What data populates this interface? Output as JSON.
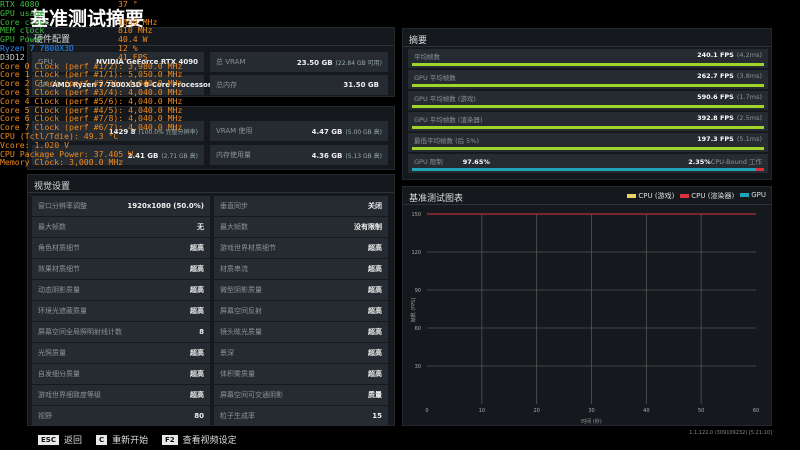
{
  "title": "基准测试摘要",
  "osd": {
    "lines": [
      {
        "label": "RTX 4080",
        "value": "37 °",
        "c": "g"
      },
      {
        "label": "GPU usage",
        "value": "",
        "c": "g"
      },
      {
        "label": "Core clock",
        "value": "1080 MHz",
        "c": "g"
      },
      {
        "label": "MEM clock",
        "value": "810 MHz",
        "c": "g"
      },
      {
        "label": "GPU Power",
        "value": "40.4 W",
        "c": "g"
      },
      {
        "label": "Ryzen 7 7800X3D",
        "value": "12 %",
        "c": "b"
      },
      {
        "label": "D3D12",
        "value": "41 FPS",
        "c": "w"
      }
    ],
    "details": [
      "Core 0 Clock (perf #1/2): 3,980.0 MHz",
      "Core 1 Clock (perf #1/1): 5,050.0 MHz",
      "Core 2 Clock (perf #2/3): 4,040.0 MHz",
      "Core 3 Clock (perf #3/4): 4,040.0 MHz",
      "Core 4 Clock (perf #5/6): 4,040.0 MHz",
      "Core 5 Clock (perf #4/5): 4,040.0 MHz",
      "Core 6 Clock (perf #7/8): 4,040.0 MHz",
      "Core 7 Clock (perf #6/7): 4,040.0 MHz",
      "CPU (Tctl/Tdie): 49.3 °C",
      "Vcore: 1.020 V",
      "CPU Package Power: 37.405 W",
      "Memory Clock: 3,000.0 MHz"
    ]
  },
  "hardware": {
    "header": "硬件配置",
    "rows": [
      {
        "l": "GPU",
        "v": "NVIDIA GeForce RTX 4090",
        "l2": "总 VRAM",
        "v2": "23.50 GB",
        "s2": "(22.84 GB 可用)"
      },
      {
        "l": "CPU",
        "v": "AMD Ryzen 7 7800X3D 8-Core Processor",
        "l2": "总内存",
        "v2": "31.50 GB",
        "s2": ""
      }
    ]
  },
  "usage": {
    "rows": [
      {
        "l": "",
        "v": "1429 8",
        "s": "(100.0% 完整分辨率)",
        "l2": "VRAM 使用",
        "v2": "4.47 GB",
        "s2": "(5.00 GB 高)"
      },
      {
        "l": "",
        "v": "2.41 GB",
        "s": "(2.71 GB 高)",
        "l2": "内存使用量",
        "v2": "4.36 GB",
        "s2": "(5.13 GB 高)"
      }
    ]
  },
  "visual": {
    "header": "视觉设置",
    "rows": [
      [
        "窗口分辨率调整",
        "1920x1080 (50.0%)",
        "垂直同步",
        "关闭"
      ],
      [
        "最大帧数",
        "无",
        "最大帧数",
        "没有限制"
      ],
      [
        "角色材质细节",
        "超高",
        "游戏世界材质细节",
        "超高"
      ],
      [
        "效果材质细节",
        "超高",
        "材质串流",
        "超高"
      ],
      [
        "动态阴影质量",
        "超高",
        "微型阴影质量",
        "超高"
      ],
      [
        "环境光遮蔽质量",
        "超高",
        "屏幕空间反射",
        "超高"
      ],
      [
        "屏幕空间全局照明射线计数",
        "8",
        "镜头眩光质量",
        "超高"
      ],
      [
        "光照质量",
        "超高",
        "景深",
        "超高"
      ],
      [
        "自发细分质量",
        "超高",
        "体积雾质量",
        "超高"
      ],
      [
        "游戏世界细致度等级",
        "超高",
        "屏幕空间可交通阴影",
        "质量"
      ],
      [
        "视野",
        "80",
        "粒子生成率",
        "15"
      ]
    ]
  },
  "summary": {
    "header": "摘要",
    "rows": [
      {
        "l": "平均帧数",
        "v": "240.1 FPS",
        "s": "(4.2ms)"
      },
      {
        "l": "GPU 平均帧数",
        "v": "262.7 FPS",
        "s": "(3.8ms)"
      },
      {
        "l": "GPU 平均帧数 (游戏)",
        "v": "590.6 FPS",
        "s": "(1.7ms)"
      },
      {
        "l": "GPU 平均帧数 (渲染器)",
        "v": "392.8 FPS",
        "s": "(2.5ms)"
      },
      {
        "l": "最低平均帧数 (后 5%)",
        "v": "197.3 FPS",
        "s": "(5.1ms)"
      }
    ],
    "bound": {
      "l": "GPU 限制",
      "gpu": "97.65%",
      "cpu": "2.35%",
      "cpu_label": "CPU-Bound 工作",
      "gpu_fraction": 0.9765,
      "gpu_color": "#1fa3b8",
      "cpu_color": "#d8323c"
    }
  },
  "chart_data": {
    "type": "line",
    "title": "基准测试图表",
    "xlabel": "时间 (秒)",
    "ylabel": "帧数 (FPS)",
    "xlim": [
      0,
      60
    ],
    "ylim": [
      0,
      150
    ],
    "xticks": [
      "0",
      "10",
      "20",
      "30",
      "40",
      "50",
      "60"
    ],
    "yticks": [
      "30",
      "60",
      "90",
      "120",
      "150"
    ],
    "grid": true,
    "legend_placement": "top-right",
    "series": [
      {
        "name": "CPU (游戏)",
        "color": "#e8d36a",
        "x": [],
        "y": []
      },
      {
        "name": "CPU (渲染器)",
        "color": "#d8323c",
        "x": [
          0,
          60
        ],
        "y": [
          150,
          150
        ]
      },
      {
        "name": "GPU",
        "color": "#1fa3b8",
        "x": [],
        "y": []
      }
    ]
  },
  "version": "1.1.122.0 (309109232) [5:21:10]",
  "hints": [
    {
      "key": "ESC",
      "label": "返回"
    },
    {
      "key": "C",
      "label": "重新开始"
    },
    {
      "key": "F2",
      "label": "查看视频设定"
    }
  ]
}
